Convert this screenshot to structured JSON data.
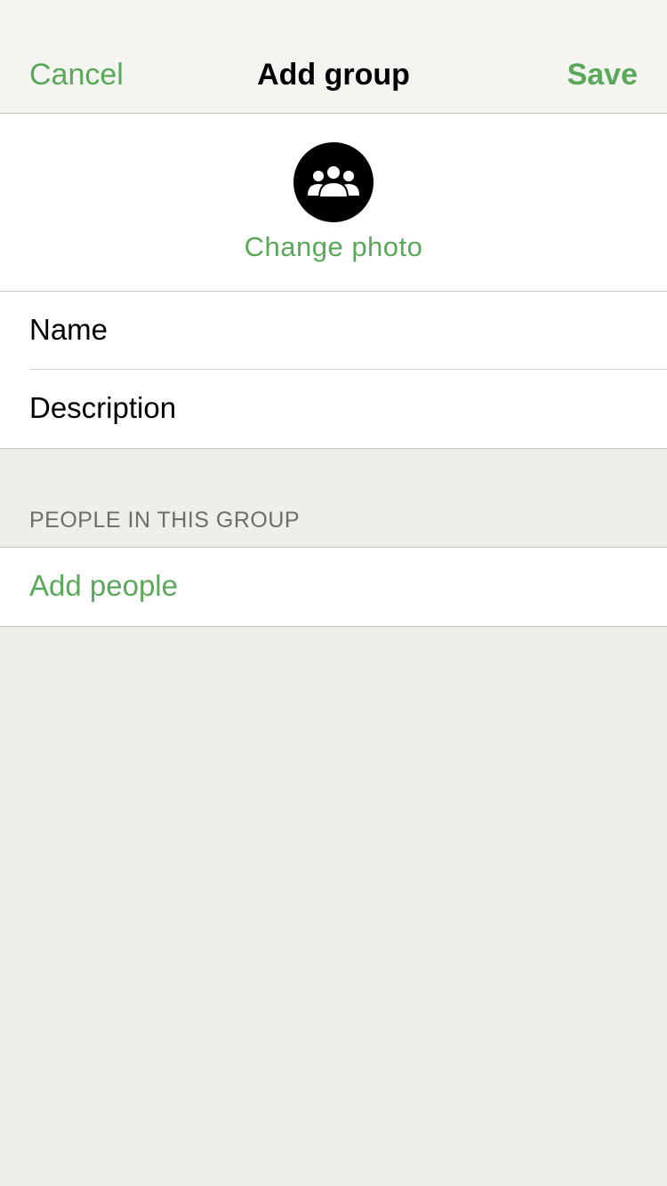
{
  "nav": {
    "cancel_label": "Cancel",
    "title": "Add group",
    "save_label": "Save"
  },
  "photo": {
    "icon": "group-icon",
    "change_label": "Change photo"
  },
  "form": {
    "name_placeholder": "Name",
    "name_value": "",
    "description_placeholder": "Description",
    "description_value": ""
  },
  "people": {
    "section_header": "PEOPLE IN THIS GROUP",
    "add_label": "Add people"
  },
  "colors": {
    "accent": "#5aa85a",
    "nav_background": "#f4f4f1",
    "page_background": "#eeeeea"
  }
}
